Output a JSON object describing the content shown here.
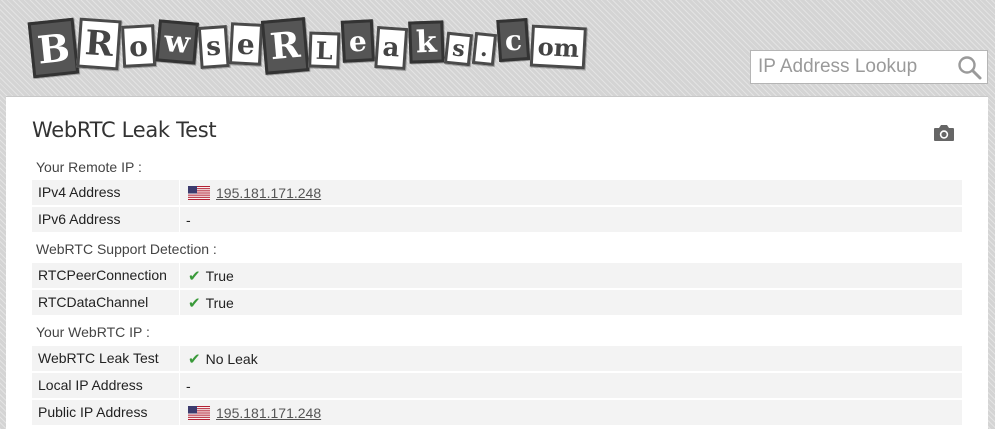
{
  "header": {
    "logo_letters": [
      "B",
      "R",
      "o",
      "w",
      "s",
      "e",
      "R",
      "L",
      "e",
      "a",
      "k",
      "s",
      ".",
      "c",
      "om"
    ],
    "logo_text": "BrowserLeaks.com",
    "search": {
      "placeholder": "IP Address Lookup",
      "value": ""
    },
    "search_icon": "magnifier-icon"
  },
  "panel": {
    "title": "WebRTC Leak Test",
    "camera_icon": "camera-icon",
    "sections": [
      {
        "label": "Your Remote IP :",
        "rows": [
          {
            "key": "IPv4 Address",
            "value": "195.181.171.248",
            "flag": "us-flag-icon",
            "link": true
          },
          {
            "key": "IPv6 Address",
            "value": "-"
          }
        ]
      },
      {
        "label": "WebRTC Support Detection :",
        "rows": [
          {
            "key": "RTCPeerConnection",
            "value": "True",
            "check": "✔"
          },
          {
            "key": "RTCDataChannel",
            "value": "True",
            "check": "✔"
          }
        ]
      },
      {
        "label": "Your WebRTC IP :",
        "rows": [
          {
            "key": "WebRTC Leak Test",
            "value": "No Leak",
            "check": "✔"
          },
          {
            "key": "Local IP Address",
            "value": "-"
          },
          {
            "key": "Public IP Address",
            "value": "195.181.171.248",
            "flag": "us-flag-icon",
            "link": true
          }
        ]
      }
    ]
  },
  "colors": {
    "check_green": "#3a9a3a",
    "row_bg": "#f3f3f3",
    "title_text": "#333333"
  }
}
